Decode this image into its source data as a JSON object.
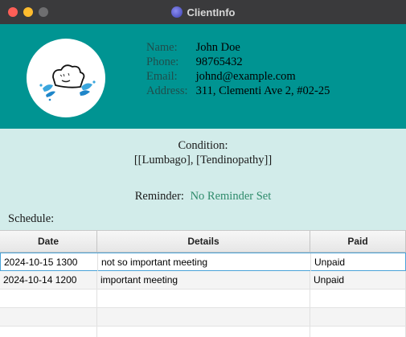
{
  "window": {
    "title": "ClientInfo",
    "colors": {
      "header": "#009492",
      "body": "#d2ecea",
      "titlebar": "#3a3a3c"
    }
  },
  "client": {
    "labels": {
      "name": "Name:",
      "phone": "Phone:",
      "email": "Email:",
      "address": "Address:"
    },
    "name": "John Doe",
    "phone": "98765432",
    "email": "johnd@example.com",
    "address": "311, Clementi Ave 2, #02-25",
    "avatar_icon": "cloud-splash-icon"
  },
  "condition": {
    "label": "Condition:",
    "value": "[[Lumbago], [Tendinopathy]]"
  },
  "reminder": {
    "label": "Reminder:",
    "value": "No Reminder Set"
  },
  "schedule": {
    "label": "Schedule:",
    "columns": [
      "Date",
      "Details",
      "Paid"
    ],
    "rows": [
      {
        "date": "2024-10-15 1300",
        "details": "not so important meeting",
        "paid": "Unpaid"
      },
      {
        "date": "2024-10-14 1200",
        "details": "important meeting",
        "paid": "Unpaid"
      }
    ]
  }
}
